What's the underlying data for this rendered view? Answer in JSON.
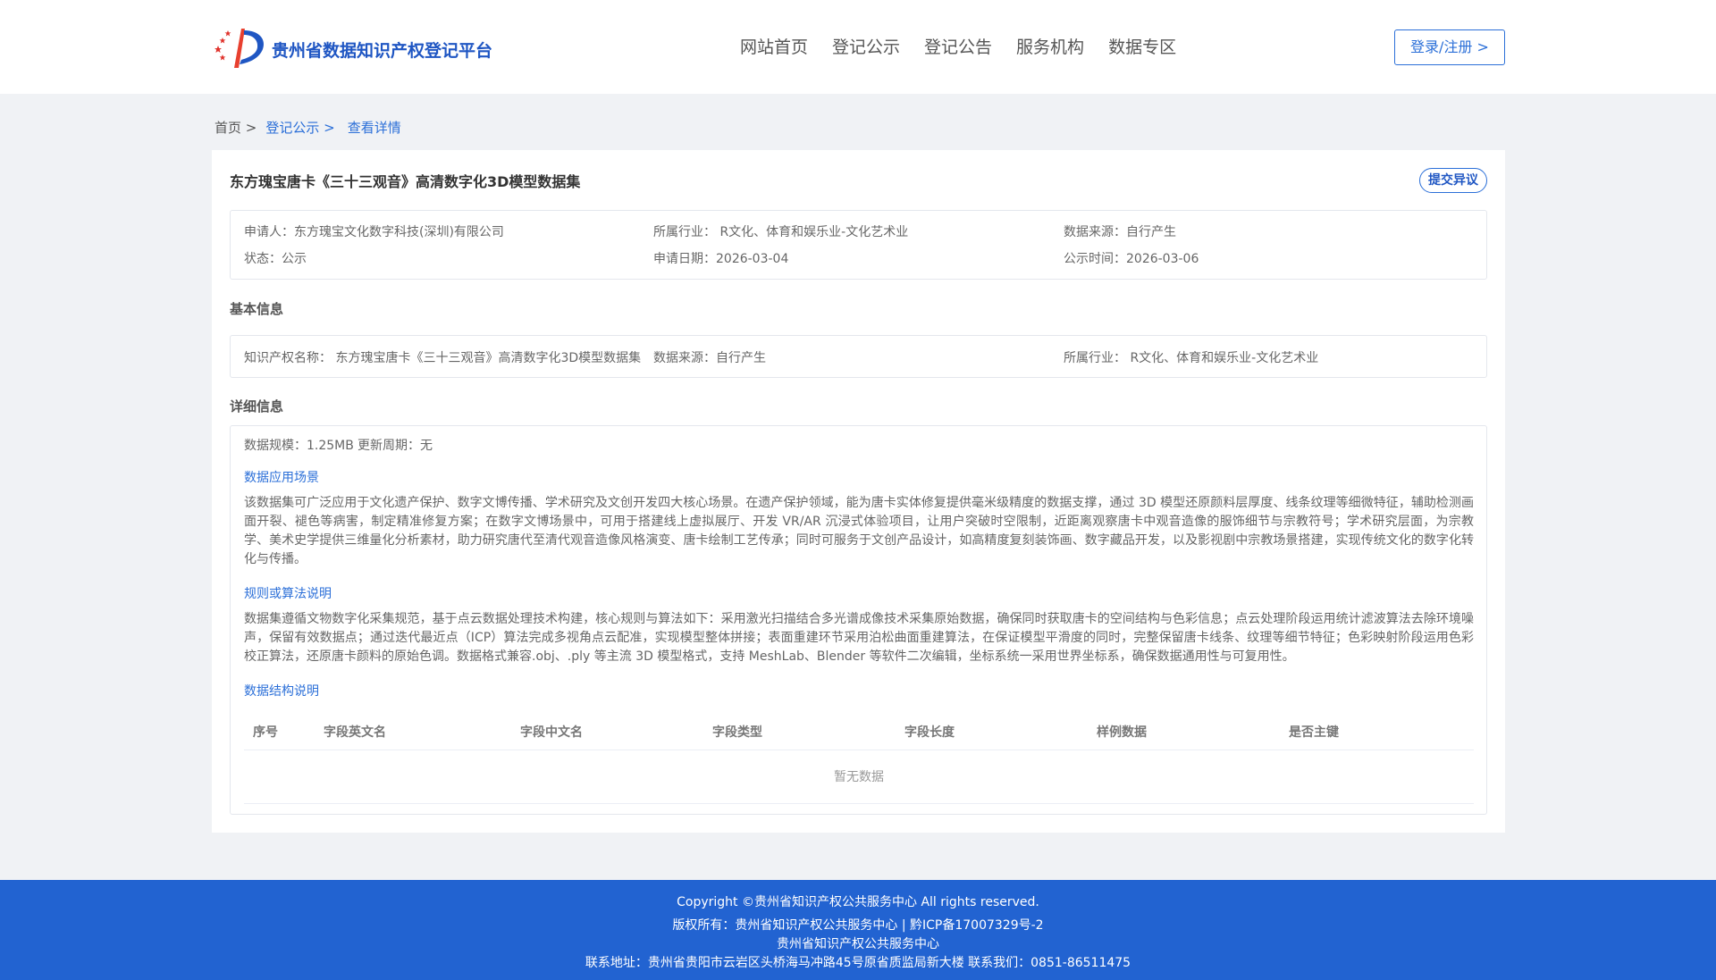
{
  "header": {
    "site_title": "贵州省数据知识产权登记平台",
    "nav": [
      "网站首页",
      "登记公示",
      "登记公告",
      "服务机构",
      "数据专区"
    ],
    "login_label": "登录/注册 >"
  },
  "breadcrumb": {
    "home": "首页 >",
    "list": "登记公示 >",
    "current": "查看详情"
  },
  "record": {
    "title": "东方瑰宝唐卡《三十三观音》高清数字化3D模型数据集",
    "objection_label": "提交异议",
    "applicant": "申请人：东方瑰宝文化数字科技(深圳)有限公司",
    "industry": "所属行业： R文化、体育和娱乐业-文化艺术业",
    "source": "数据来源：自行产生",
    "status": "状态：公示",
    "apply_date": "申请日期：2026-03-04",
    "publicity_date": "公示时间：2026-03-06"
  },
  "basic_info": {
    "section_title": "基本信息",
    "ip_name": "知识产权名称： 东方瑰宝唐卡《三十三观音》高清数字化3D模型数据集",
    "source": "数据来源：自行产生",
    "industry": "所属行业： R文化、体育和娱乐业-文化艺术业"
  },
  "detail_info": {
    "section_title": "详细信息",
    "scale": "数据规模：1.25MB",
    "update_cycle": "更新周期：无",
    "scenario_title": "数据应用场景",
    "scenario_text": "该数据集可广泛应用于文化遗产保护、数字文博传播、学术研究及文创开发四大核心场景。在遗产保护领域，能为唐卡实体修复提供毫米级精度的数据支撑，通过 3D 模型还原颜料层厚度、线条纹理等细微特征，辅助检测画面开裂、褪色等病害，制定精准修复方案；在数字文博场景中，可用于搭建线上虚拟展厅、开发 VR/AR 沉浸式体验项目，让用户突破时空限制，近距离观察唐卡中观音造像的服饰细节与宗教符号；学术研究层面，为宗教学、美术史学提供三维量化分析素材，助力研究唐代至清代观音造像风格演变、唐卡绘制工艺传承；同时可服务于文创产品设计，如高精度复刻装饰画、数字藏品开发，以及影视剧中宗教场景搭建，实现传统文化的数字化转化与传播。",
    "algorithm_title": "规则或算法说明",
    "algorithm_text": "数据集遵循文物数字化采集规范，基于点云数据处理技术构建，核心规则与算法如下：采用激光扫描结合多光谱成像技术采集原始数据，确保同时获取唐卡的空间结构与色彩信息；点云处理阶段运用统计滤波算法去除环境噪声，保留有效数据点；通过迭代最近点（ICP）算法完成多视角点云配准，实现模型整体拼接；表面重建环节采用泊松曲面重建算法，在保证模型平滑度的同时，完整保留唐卡线条、纹理等细节特征；色彩映射阶段运用色彩校正算法，还原唐卡颜料的原始色调。数据格式兼容.obj、.ply 等主流 3D 模型格式，支持 MeshLab、Blender 等软件二次编辑，坐标系统一采用世界坐标系，确保数据通用性与可复用性。",
    "structure_title": "数据结构说明",
    "table_headers": [
      "序号",
      "字段英文名",
      "字段中文名",
      "字段类型",
      "字段长度",
      "样例数据",
      "是否主键"
    ],
    "table_empty": "暂无数据"
  },
  "footer": {
    "copyright": "Copyright ©贵州省知识产权公共服务中心 All rights reserved.",
    "owner": "版权所有：贵州省知识产权公共服务中心 | 黔ICP备17007329号-2",
    "org": "贵州省知识产权公共服务中心",
    "contact": "联系地址：贵州省贵阳市云岩区头桥海马冲路45号原省质监局新大楼 联系我们：0851-86511475"
  },
  "colors": {
    "primary": "#2b6fd8",
    "footer_bg": "#2263d1",
    "logo_red": "#e0322b"
  }
}
